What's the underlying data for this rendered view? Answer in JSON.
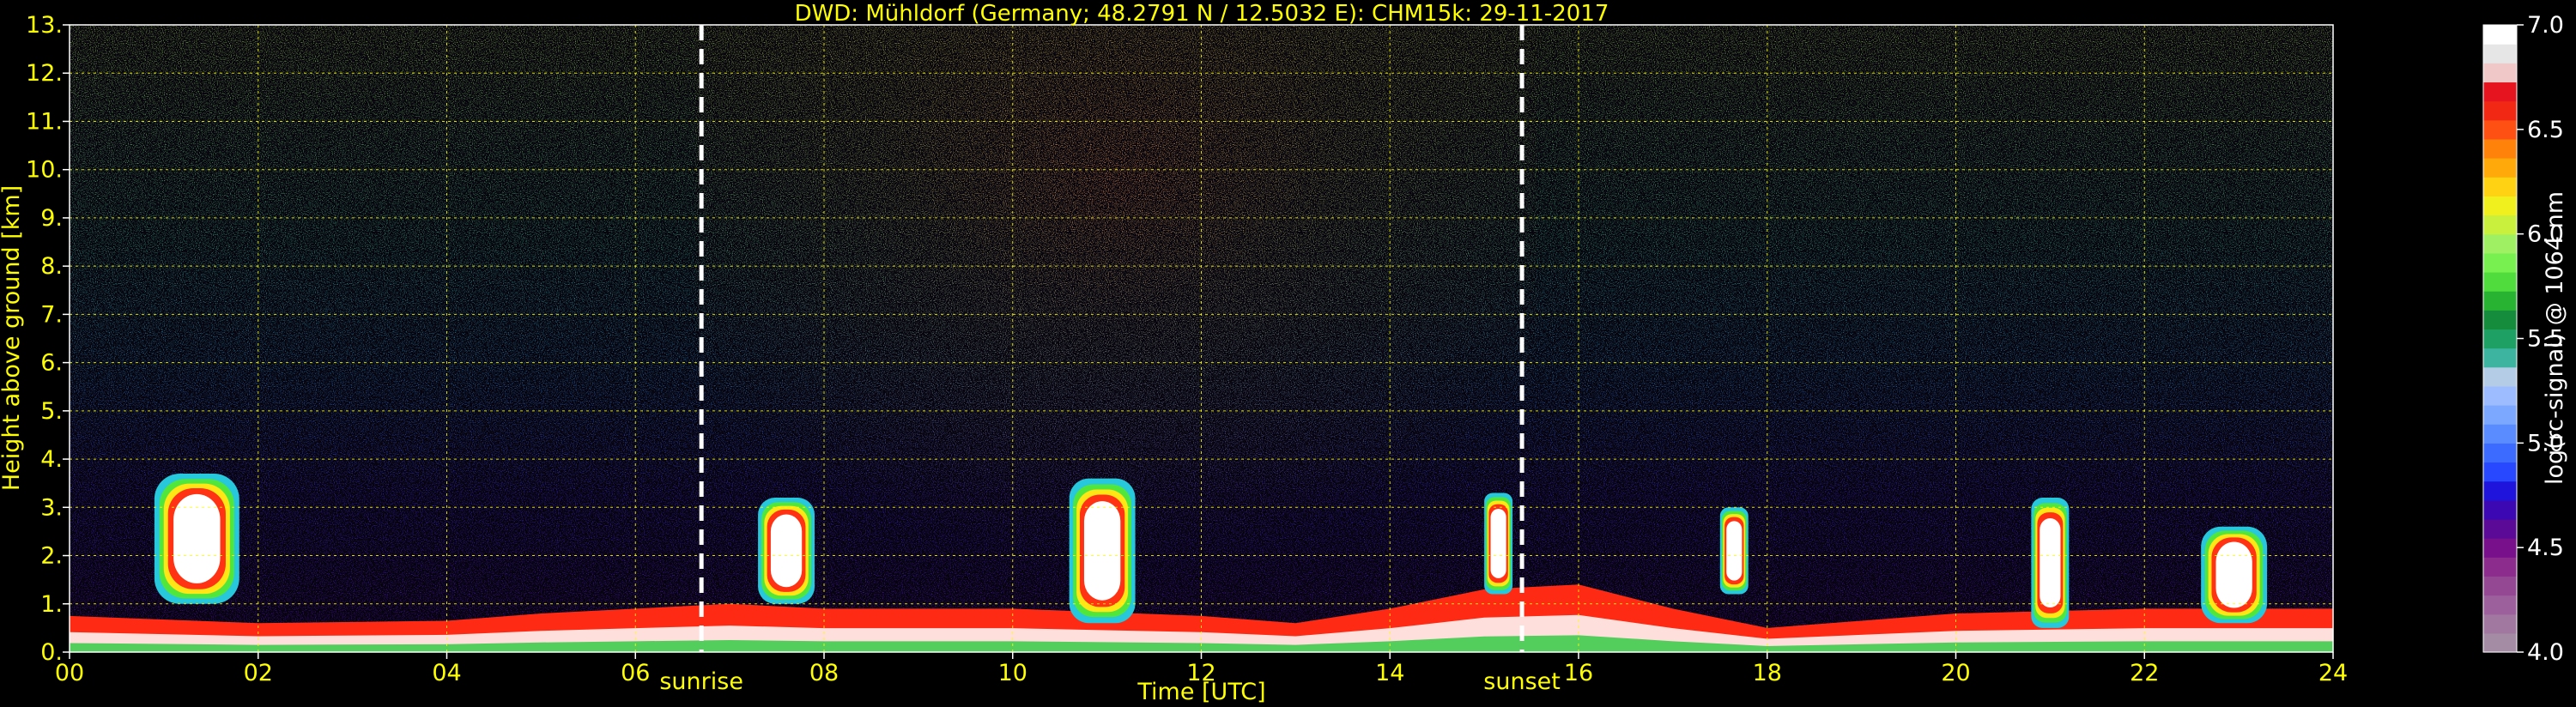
{
  "chart_data": {
    "type": "heatmap",
    "title": "DWD: Mühldorf (Germany; 48.2791 N / 12.5032 E):    CHM15k: 29-11-2017",
    "xlabel": "Time [UTC]",
    "ylabel": "Height above ground [km]",
    "xlim": [
      0,
      24
    ],
    "ylim": [
      0,
      13
    ],
    "x_ticks": [
      "00",
      "02",
      "04",
      "06",
      "08",
      "10",
      "12",
      "14",
      "16",
      "18",
      "20",
      "22",
      "24"
    ],
    "x_tick_values": [
      0,
      2,
      4,
      6,
      8,
      10,
      12,
      14,
      16,
      18,
      20,
      22,
      24
    ],
    "y_ticks": [
      "0.",
      "1.",
      "2.",
      "3.",
      "4.",
      "5.",
      "6.",
      "7.",
      "8.",
      "9.",
      "10.",
      "11.",
      "12.",
      "13."
    ],
    "y_tick_values": [
      0,
      1,
      2,
      3,
      4,
      5,
      6,
      7,
      8,
      9,
      10,
      11,
      12,
      13
    ],
    "grid": true,
    "annotations": [
      {
        "label": "sunrise",
        "x": 6.7
      },
      {
        "label": "sunset",
        "x": 15.4
      }
    ],
    "colorbar": {
      "label": "log(rc-signal) @ 1064 nm",
      "range": [
        4.0,
        7.0
      ],
      "ticks": [
        "4.0",
        "4.5",
        "5.0",
        "5.5",
        "6.0",
        "6.5",
        "7.0"
      ],
      "tick_values": [
        4.0,
        4.5,
        5.0,
        5.5,
        6.0,
        6.5,
        7.0
      ],
      "colors": [
        "#a48ca4",
        "#a078a0",
        "#9c609c",
        "#944894",
        "#8c2c8c",
        "#78108c",
        "#5a0a96",
        "#3c08b4",
        "#1e14dc",
        "#2848ff",
        "#3c6cff",
        "#5a8cff",
        "#7ca8ff",
        "#9cbcff",
        "#b4cce6",
        "#3cb4a0",
        "#1ea064",
        "#148c3c",
        "#28b432",
        "#50dc3c",
        "#78f050",
        "#a0f064",
        "#c8f03c",
        "#f0f01e",
        "#ffd214",
        "#ffaa0a",
        "#ff820a",
        "#ff5014",
        "#f02814",
        "#e6141e",
        "#f0c8c8",
        "#e6e6e6",
        "#ffffff"
      ]
    },
    "cloud_events": [
      {
        "start": 0.9,
        "end": 1.8,
        "bottom": 1.0,
        "top": 3.7
      },
      {
        "start": 7.3,
        "end": 7.9,
        "bottom": 1.0,
        "top": 3.2
      },
      {
        "start": 10.6,
        "end": 11.3,
        "bottom": 0.6,
        "top": 3.6
      },
      {
        "start": 15.0,
        "end": 15.3,
        "bottom": 1.2,
        "top": 3.3
      },
      {
        "start": 17.5,
        "end": 17.8,
        "bottom": 1.2,
        "top": 3.0
      },
      {
        "start": 20.8,
        "end": 21.2,
        "bottom": 0.5,
        "top": 3.2
      },
      {
        "start": 22.6,
        "end": 23.3,
        "bottom": 0.6,
        "top": 2.6
      }
    ],
    "boundary_layer": [
      [
        0,
        0.75
      ],
      [
        2,
        0.6
      ],
      [
        4,
        0.65
      ],
      [
        5,
        0.8
      ],
      [
        6,
        0.9
      ],
      [
        7,
        1.0
      ],
      [
        8,
        0.9
      ],
      [
        10,
        0.9
      ],
      [
        12,
        0.75
      ],
      [
        13,
        0.6
      ],
      [
        14,
        0.9
      ],
      [
        15,
        1.3
      ],
      [
        16,
        1.4
      ],
      [
        17,
        0.9
      ],
      [
        18,
        0.5
      ],
      [
        20,
        0.8
      ],
      [
        22,
        0.9
      ],
      [
        24,
        0.9
      ]
    ]
  }
}
